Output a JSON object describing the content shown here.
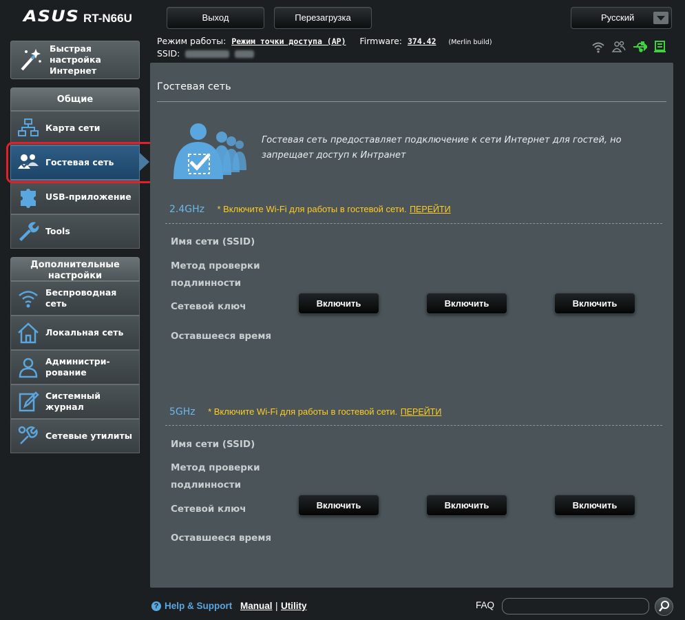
{
  "header": {
    "brand": "ASUS",
    "model": "RT-N66U",
    "logout_label": "Выход",
    "reboot_label": "Перезагрузка",
    "language": "Русский"
  },
  "info": {
    "mode_label": "Режим работы:",
    "mode_value": "Режим точки доступа (AP)",
    "firmware_label": "Firmware:",
    "firmware_value": "374.42",
    "firmware_note": "(Merlin build)",
    "ssid_label": "SSID:"
  },
  "sidebar": {
    "quick_setup": "Быстрая настройка Интернет",
    "general_header": "Общие",
    "general_items": [
      {
        "label": "Карта сети",
        "icon": "network-map-icon"
      },
      {
        "label": "Гостевая сеть",
        "icon": "guest-network-icon",
        "active": true
      },
      {
        "label": "USB-приложение",
        "icon": "usb-app-icon"
      },
      {
        "label": "Tools",
        "icon": "tools-icon"
      }
    ],
    "advanced_header": "Дополнительные настройки",
    "advanced_items": [
      {
        "label": "Беспроводная сеть",
        "icon": "wireless-icon"
      },
      {
        "label": "Локальная сеть",
        "icon": "lan-icon"
      },
      {
        "label": "Администри-рование",
        "icon": "admin-icon"
      },
      {
        "label": "Системный журнал",
        "icon": "syslog-icon"
      },
      {
        "label": "Сетевые утилиты",
        "icon": "network-tools-icon"
      }
    ]
  },
  "main": {
    "title": "Гостевая сеть",
    "description": "Гостевая сеть предоставляет подключение к сети Интернет для гостей, но запрещает доступ к Интранет",
    "bands": [
      {
        "name": "2.4GHz",
        "note": "* Включите Wi-Fi для работы в гостевой сети.",
        "link": "ПЕРЕЙТИ",
        "fields": [
          "Имя сети (SSID)",
          "Метод проверки подлинности",
          "Сетевой ключ",
          "Оставшееся время"
        ],
        "buttons": [
          "Включить",
          "Включить",
          "Включить"
        ]
      },
      {
        "name": "5GHz",
        "note": "* Включите Wi-Fi для работы в гостевой сети.",
        "link": "ПЕРЕЙТИ",
        "fields": [
          "Имя сети (SSID)",
          "Метод проверки подлинности",
          "Сетевой ключ",
          "Оставшееся время"
        ],
        "buttons": [
          "Включить",
          "Включить",
          "Включить"
        ]
      }
    ]
  },
  "footer": {
    "help": "Help & Support",
    "manual": "Manual",
    "separator": "|",
    "utility": "Utility",
    "faq_label": "FAQ",
    "faq_value": ""
  },
  "colors": {
    "accent_blue": "#5aa6de",
    "warning_yellow": "#ffcc22",
    "active_menu": "#2e5d85",
    "highlight_red": "#e0202a",
    "panel": "#4b5559",
    "status_green": "#3fd23f"
  }
}
